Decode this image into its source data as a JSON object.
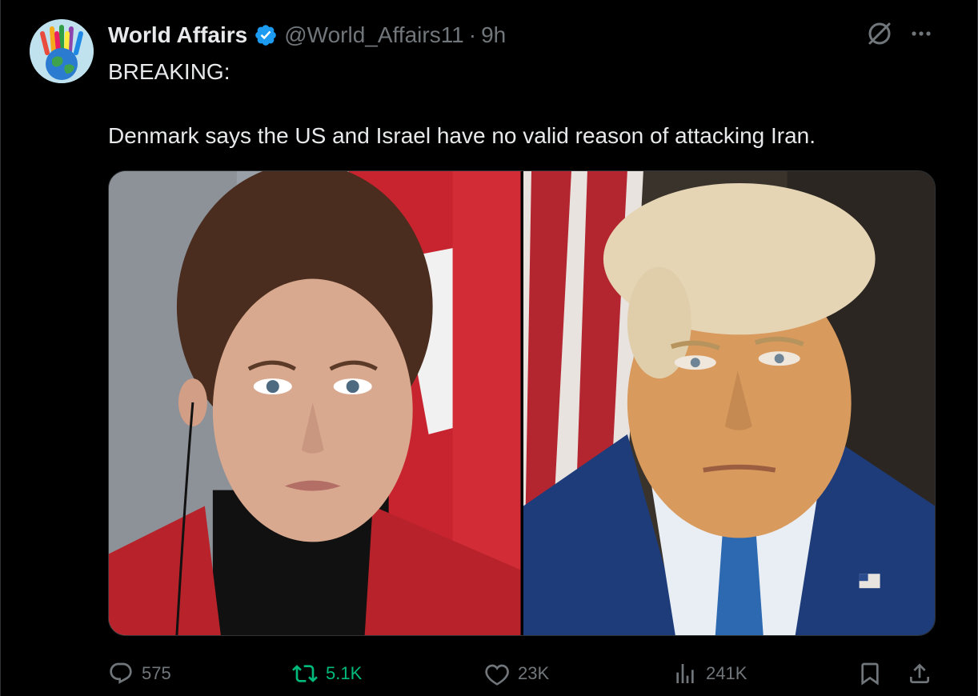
{
  "tweet": {
    "author_name": "World Affairs",
    "handle": "@World_Affairs11",
    "separator": "·",
    "time": "9h",
    "text": "BREAKING:\n\nDenmark says the US and Israel have no valid reason of attacking Iran."
  },
  "actions": {
    "replies": "575",
    "reposts": "5.1K",
    "likes": "23K",
    "views": "241K"
  },
  "icons": {
    "verified": "verified-badge-icon",
    "grok": "grok-icon",
    "more": "more-icon",
    "reply": "reply-icon",
    "repost": "repost-icon",
    "like": "like-icon",
    "views": "views-icon",
    "bookmark": "bookmark-icon",
    "share": "share-icon"
  },
  "colors": {
    "background": "#000000",
    "text": "#e7e9ea",
    "muted": "#71767b",
    "verified": "#1d9bf0",
    "repost_active": "#00ba7c",
    "border": "#2f3336"
  }
}
